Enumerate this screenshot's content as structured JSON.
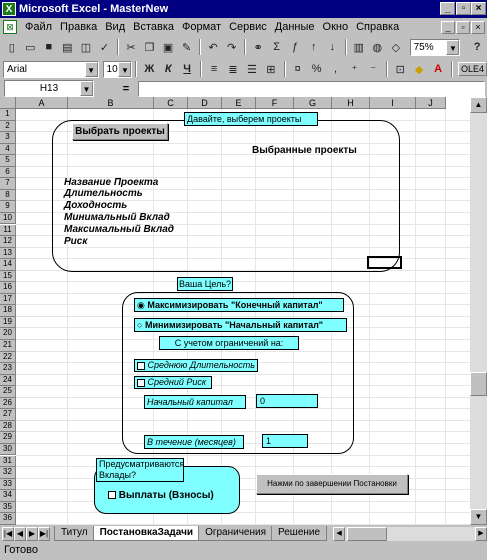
{
  "window": {
    "title": "Microsoft Excel - MasterNew",
    "minimize": "_",
    "restore": "▫",
    "close": "×"
  },
  "menu": [
    "Файл",
    "Правка",
    "Вид",
    "Вставка",
    "Формат",
    "Сервис",
    "Данные",
    "Окно",
    "Справка"
  ],
  "doc_controls": {
    "minimize": "_",
    "restore": "▫",
    "close": "×"
  },
  "toolbar1": {
    "icons": [
      "new-icon",
      "open-icon",
      "save-icon",
      "print-icon",
      "preview-icon",
      "spell-icon",
      "cut-icon",
      "copy-icon",
      "paste-icon",
      "format-painter-icon",
      "undo-icon",
      "redo-icon",
      "hyperlink-icon",
      "autosum-icon",
      "function-icon",
      "sort-asc-icon",
      "sort-desc-icon",
      "chart-wizard-icon",
      "map-icon",
      "drawing-icon"
    ],
    "zoom": "75%",
    "help": "?"
  },
  "toolbar2": {
    "font": "Arial",
    "size": "10",
    "bold": "Ж",
    "italic": "К",
    "underline": "Ч",
    "extra": "OLE4"
  },
  "formula": {
    "cellref": "H13",
    "eq": "=",
    "value": ""
  },
  "columns": [
    "A",
    "B",
    "C",
    "D",
    "E",
    "F",
    "G",
    "H",
    "I",
    "J"
  ],
  "rows": [
    "1",
    "2",
    "3",
    "4",
    "5",
    "6",
    "7",
    "8",
    "9",
    "10",
    "11",
    "12",
    "13",
    "14",
    "15",
    "16",
    "17",
    "18",
    "19",
    "20",
    "21",
    "22",
    "23",
    "24",
    "25",
    "26",
    "27",
    "28",
    "29",
    "30",
    "31",
    "32",
    "33",
    "34",
    "35",
    "36"
  ],
  "form": {
    "select_btn": "Выбрать проекты",
    "header_note": "Давайте, выберем проекты",
    "selected_title": "Выбранные проекты",
    "project_fields": [
      "Название Проекта",
      "Длительность",
      "Доходность",
      "Минимальный Вклад",
      "Максимальный Вклад",
      "Риск"
    ],
    "goal_label": "Ваша Цель?",
    "goal_options": [
      "Максимизировать \"Конечный капитал\"",
      "Минимизировать \"Начальный капитал\""
    ],
    "constraints_title": "С учетом ограничений на:",
    "constraint_checks": [
      "Среднюю Длительность",
      "Средний Риск"
    ],
    "initial_capital_label": "Начальный капитал",
    "initial_capital_value": "0",
    "period_label": "В течение (месяцев)",
    "period_value": "1",
    "deposits_question": "Предусматриваются Вклады?",
    "deposits_check": "Выплаты (Взносы)",
    "submit_btn": "Нажми по завершении Постановки"
  },
  "tabs": [
    "Титул",
    "ПостановкаЗадачи",
    "Ограничения",
    "Решение"
  ],
  "active_tab": "ПостановкаЗадачи",
  "status": "Готово"
}
